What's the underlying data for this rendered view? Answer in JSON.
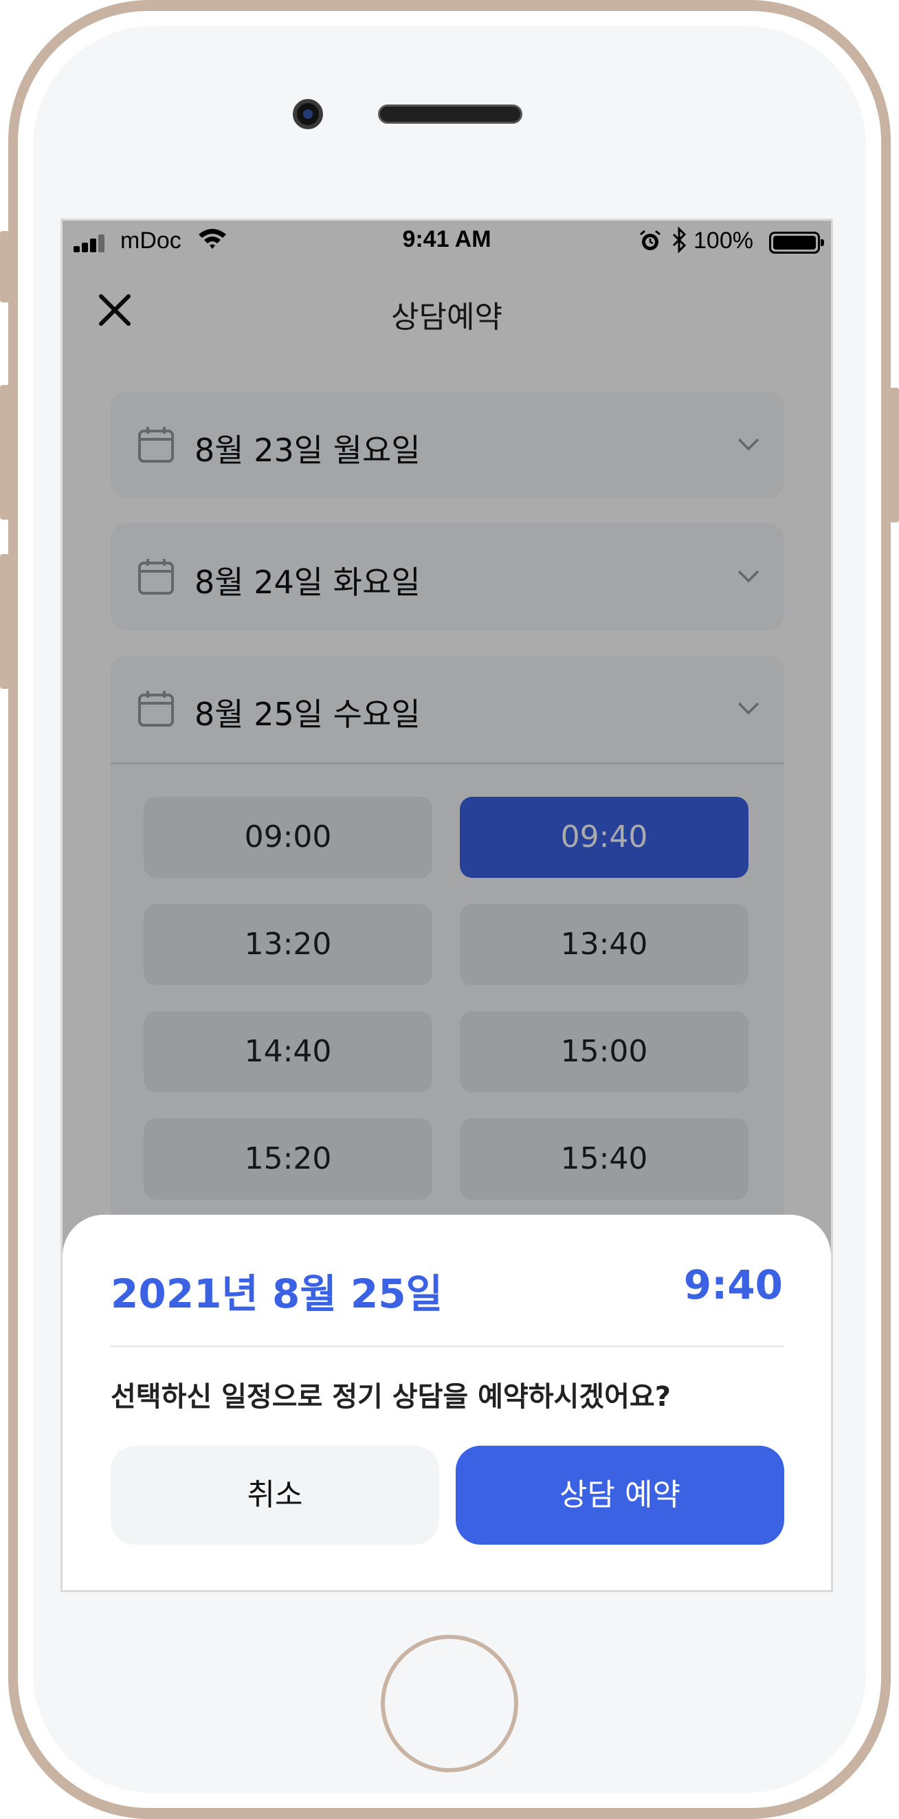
{
  "status_bar": {
    "carrier": "mDoc",
    "time": "9:41 AM",
    "battery": "100%"
  },
  "header": {
    "title": "상담예약",
    "close_icon": "close-icon"
  },
  "dates": [
    {
      "label": "8월 23일 월요일",
      "expanded": false
    },
    {
      "label": "8월 24일 화요일",
      "expanded": false
    },
    {
      "label": "8월 25일 수요일",
      "expanded": true
    }
  ],
  "time_slots": [
    "09:00",
    "09:40",
    "13:20",
    "13:40",
    "14:40",
    "15:00",
    "15:20",
    "15:40"
  ],
  "selected_slot": "09:40",
  "sheet": {
    "date": "2021년 8월 25일",
    "time": "9:40",
    "question": "선택하신 일정으로 정기 상담을 예약하시겠어요?",
    "cancel_label": "취소",
    "confirm_label": "상담 예약"
  },
  "colors": {
    "accent": "#3b62e3",
    "overlay": "rgba(0,0,0,0.33)"
  }
}
